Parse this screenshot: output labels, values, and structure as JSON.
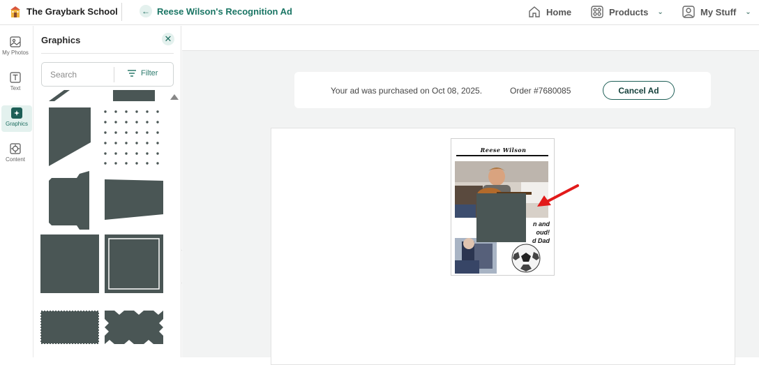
{
  "header": {
    "school_name": "The Graybark School",
    "ad_title": "Reese Wilson's Recognition Ad",
    "nav": [
      {
        "label": "Home",
        "icon": "home-icon"
      },
      {
        "label": "Products",
        "icon": "grid-icon"
      },
      {
        "label": "My Stuff",
        "icon": "user-icon"
      }
    ]
  },
  "rail": {
    "items": [
      {
        "label": "My Photos",
        "icon": "photo-icon",
        "active": false
      },
      {
        "label": "Text",
        "icon": "text-icon",
        "active": false
      },
      {
        "label": "Graphics",
        "icon": "graphics-icon",
        "active": true
      },
      {
        "label": "Content",
        "icon": "content-icon",
        "active": false
      }
    ]
  },
  "panel": {
    "title": "Graphics",
    "search_placeholder": "Search",
    "filter_label": "Filter"
  },
  "notice": {
    "purchase_text": "Your ad was purchased on Oct 08, 2025.",
    "order_text": "Order #7680085",
    "cancel_label": "Cancel Ad"
  },
  "ad": {
    "name": "Reese Wilson",
    "caption_lines": [
      "n and",
      "oud!",
      "d Dad"
    ]
  },
  "colors": {
    "brand_green": "#1a7564",
    "graphic_fill": "#4a5655",
    "annotation_red": "#e21a1a"
  }
}
